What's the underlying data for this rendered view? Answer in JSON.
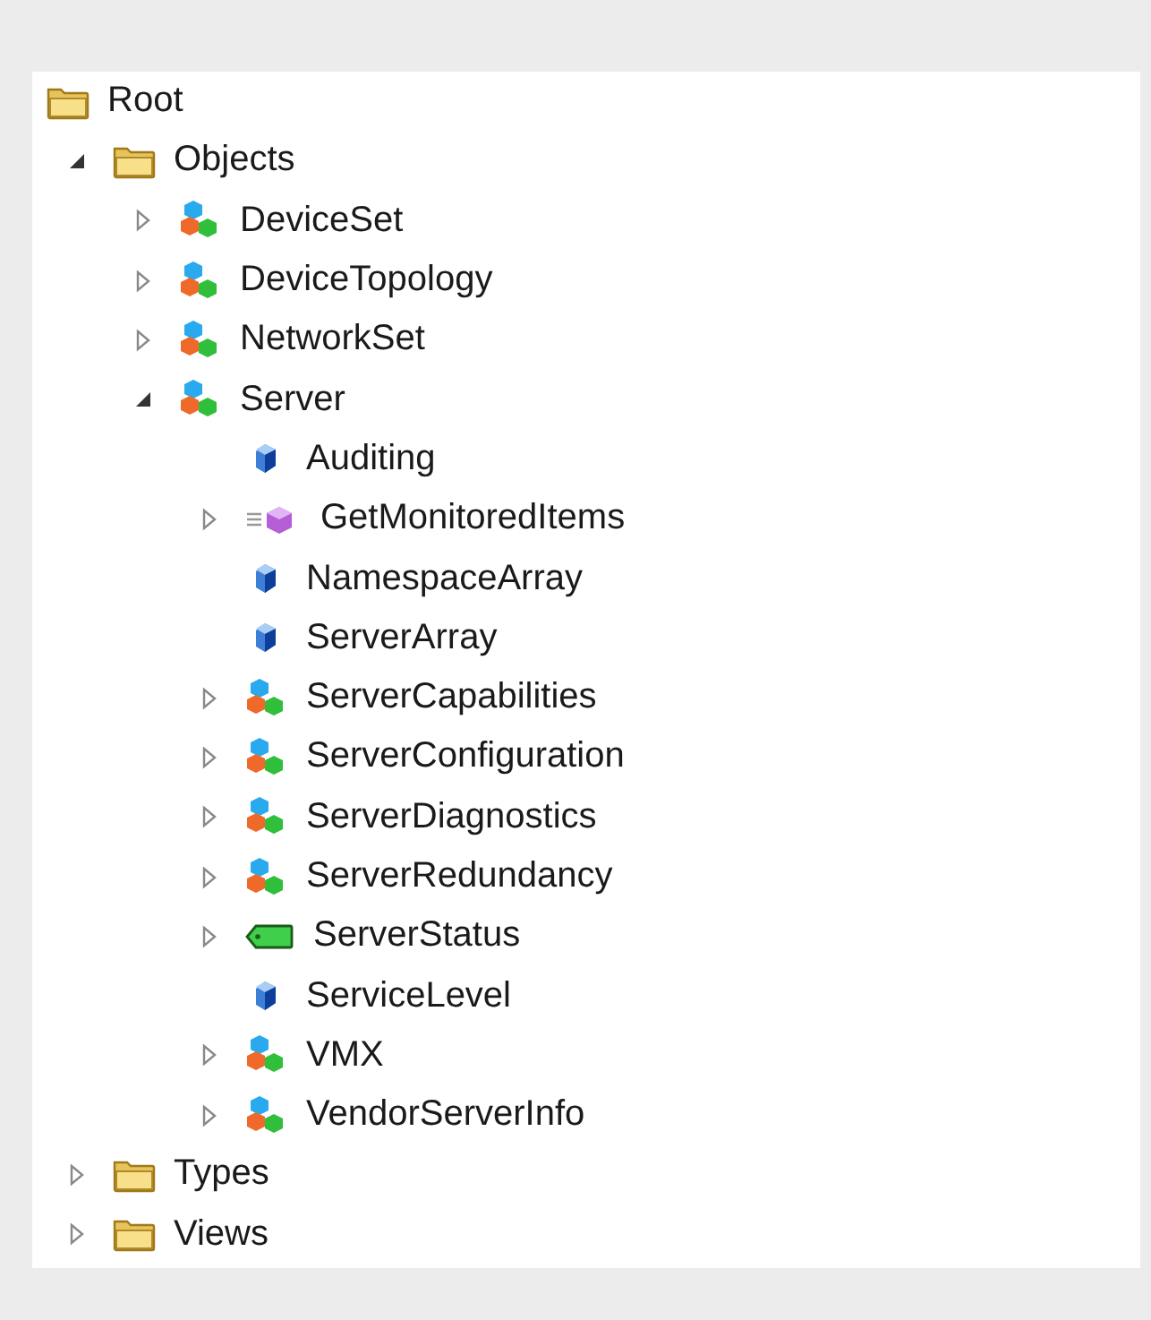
{
  "tree": {
    "nodes": [
      {
        "label": "Root",
        "kind": "folder",
        "children": [
          {
            "label": "Objects",
            "kind": "folder",
            "expanded": true,
            "children": [
              {
                "label": "DeviceSet",
                "kind": "object",
                "expanded": false
              },
              {
                "label": "DeviceTopology",
                "kind": "object",
                "expanded": false
              },
              {
                "label": "NetworkSet",
                "kind": "object",
                "expanded": false
              },
              {
                "label": "Server",
                "kind": "object",
                "expanded": true,
                "children": [
                  {
                    "label": "Auditing",
                    "kind": "variable"
                  },
                  {
                    "label": "GetMonitoredItems",
                    "kind": "method",
                    "expanded": false
                  },
                  {
                    "label": "NamespaceArray",
                    "kind": "variable"
                  },
                  {
                    "label": "ServerArray",
                    "kind": "variable"
                  },
                  {
                    "label": "ServerCapabilities",
                    "kind": "object",
                    "expanded": false
                  },
                  {
                    "label": "ServerConfiguration",
                    "kind": "object",
                    "expanded": false
                  },
                  {
                    "label": "ServerDiagnostics",
                    "kind": "object",
                    "expanded": false
                  },
                  {
                    "label": "ServerRedundancy",
                    "kind": "object",
                    "expanded": false
                  },
                  {
                    "label": "ServerStatus",
                    "kind": "datatype",
                    "expanded": false
                  },
                  {
                    "label": "ServiceLevel",
                    "kind": "variable"
                  },
                  {
                    "label": "VMX",
                    "kind": "object",
                    "expanded": false
                  },
                  {
                    "label": "VendorServerInfo",
                    "kind": "object",
                    "expanded": false
                  }
                ]
              }
            ]
          },
          {
            "label": "Types",
            "kind": "folder",
            "expanded": false
          },
          {
            "label": "Views",
            "kind": "folder",
            "expanded": false
          }
        ]
      }
    ]
  }
}
